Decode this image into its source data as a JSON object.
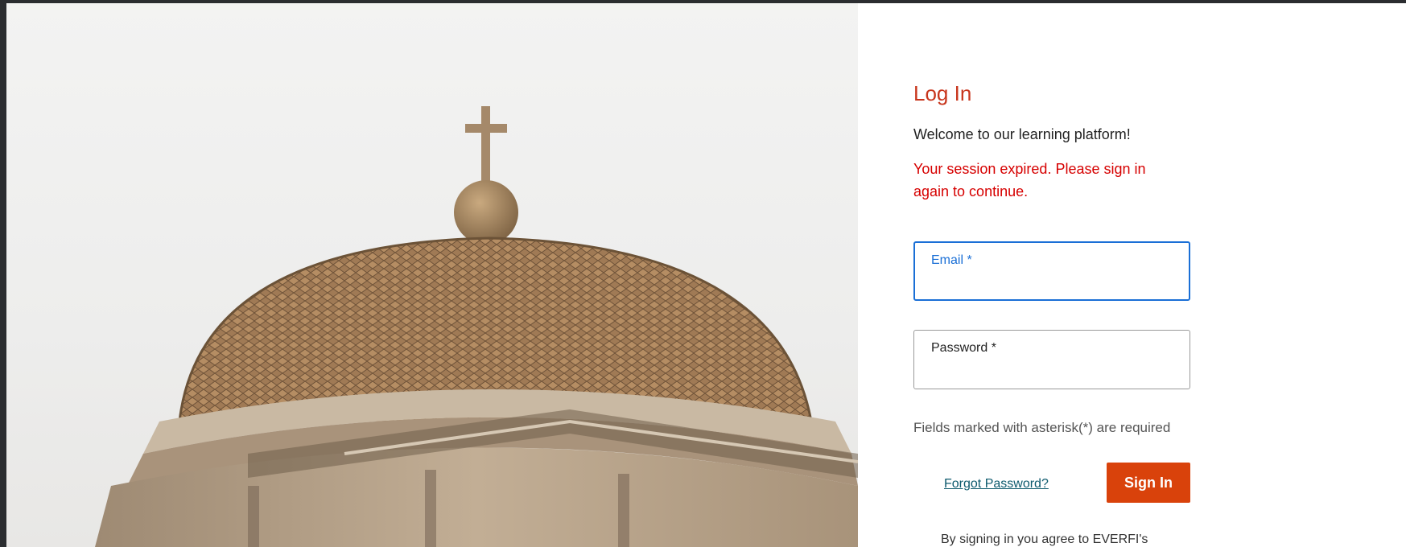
{
  "login": {
    "title": "Log In",
    "welcome": "Welcome to our learning platform!",
    "error": "Your session expired. Please sign in again to continue.",
    "email_label": "Email *",
    "email_value": "",
    "password_label": "Password *",
    "password_value": "",
    "required_note": "Fields marked with asterisk(*) are required",
    "forgot_link": "Forgot Password?",
    "signin_button": "Sign In",
    "terms_text": "By signing in you agree to EVERFI's"
  },
  "colors": {
    "title": "#c8361d",
    "error": "#d60000",
    "focus_border": "#1a6fd6",
    "button": "#d9420b",
    "link": "#0e5a6e"
  },
  "hero": {
    "image": "domed-building-with-cross"
  }
}
